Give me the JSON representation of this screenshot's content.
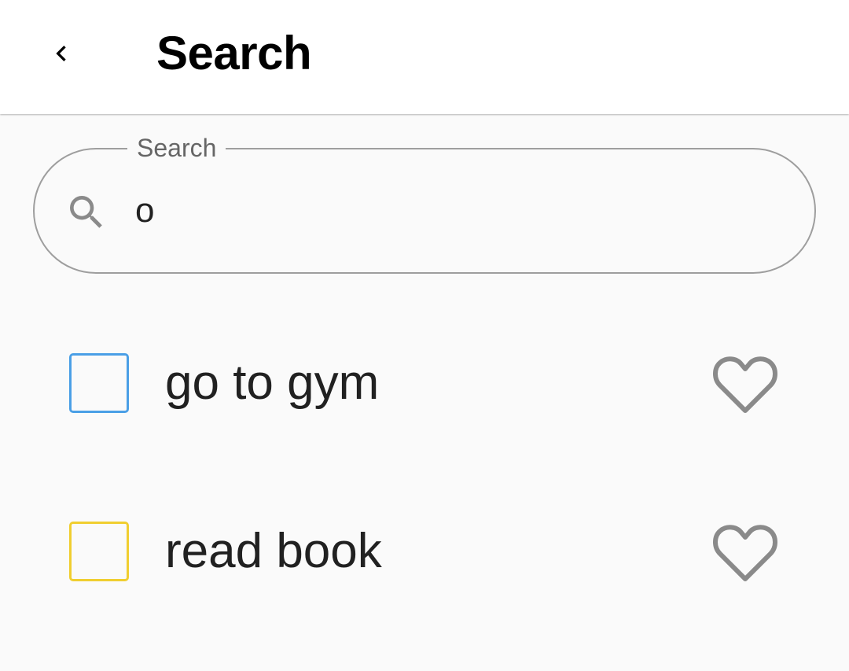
{
  "header": {
    "back_icon": "chevron-left-icon",
    "title": "Search"
  },
  "search": {
    "label": "Search",
    "value": "o",
    "icon": "search-icon"
  },
  "items": [
    {
      "label": "go to gym",
      "checked": false,
      "favorite": false,
      "checkbox_color": "#4a9fe6",
      "favorite_icon": "heart-outline-icon"
    },
    {
      "label": "read book",
      "checked": false,
      "favorite": false,
      "checkbox_color": "#f0ce30",
      "favorite_icon": "heart-outline-icon"
    }
  ],
  "colors": {
    "icon_gray": "#8a8a8a",
    "outline_gray": "#9e9e9e",
    "background": "#fafafa"
  }
}
